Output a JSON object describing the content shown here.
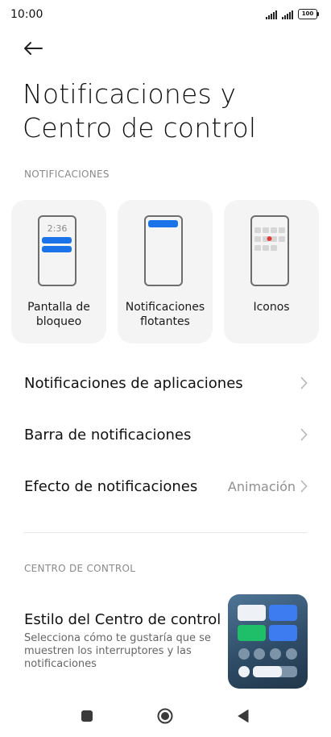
{
  "status": {
    "time": "10:00",
    "battery": "100"
  },
  "header": {
    "title": "Notificaciones y Centro de control"
  },
  "notifications": {
    "section_label": "NOTIFICACIONES",
    "cards": [
      {
        "label": "Pantalla de bloqueo",
        "clock": "2:36"
      },
      {
        "label": "Notificaciones flotantes"
      },
      {
        "label": "Iconos"
      }
    ],
    "rows": [
      {
        "title": "Notificaciones de aplicaciones",
        "value": ""
      },
      {
        "title": "Barra de notificaciones",
        "value": ""
      },
      {
        "title": "Efecto de notificaciones",
        "value": "Animación"
      }
    ]
  },
  "control_center": {
    "section_label": "CENTRO DE CONTROL",
    "style_title": "Estilo del Centro de control",
    "style_description": "Selecciona cómo te gustaría que se muestren los interruptores y las notificaciones"
  },
  "colors": {
    "accent": "#1a73e8",
    "dot": "#e53935"
  },
  "icons": {
    "back": "arrow-left-icon",
    "chevron": "chevron-right-icon",
    "nav": [
      "square-icon",
      "circle-icon",
      "triangle-left-icon"
    ]
  }
}
